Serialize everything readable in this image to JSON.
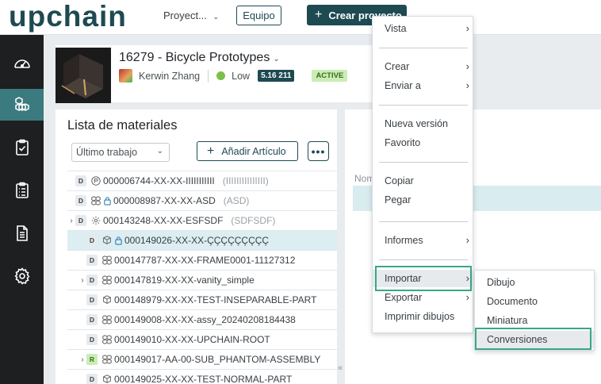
{
  "topbar": {
    "logo": "upchain",
    "project_dropdown": "Proyect...",
    "equipo_label": "Equipo",
    "crear_label": "Crear proyecto"
  },
  "sidebar": {
    "items": [
      {
        "name": "dashboard",
        "icon": "speedometer-icon"
      },
      {
        "name": "parts",
        "icon": "cubes-icon",
        "active": true
      },
      {
        "name": "tasks",
        "icon": "clipboard-check-icon"
      },
      {
        "name": "lists",
        "icon": "clipboard-list-icon"
      },
      {
        "name": "documents",
        "icon": "document-icon"
      },
      {
        "name": "settings",
        "icon": "gear-icon"
      }
    ]
  },
  "project": {
    "title": "16279 - Bicycle Prototypes",
    "owner": "Kerwin Zhang",
    "priority": "Low",
    "version": "5.16 211",
    "status": "ACTIVE"
  },
  "bom": {
    "title": "Lista de materiales",
    "filter_value": "Último trabajo",
    "add_label": "Añadir Artículo",
    "more_label": "•••",
    "rows": [
      {
        "expand": "",
        "badge": "D",
        "icon": "assembly",
        "locked": false,
        "text": "000006744-XX-XX-IIIIIIIIIII",
        "desc": "(IIIIIIIIIIIIIII)",
        "indent": 0
      },
      {
        "expand": "",
        "badge": "D",
        "icon": "assembly",
        "locked": true,
        "text": "000008987-XX-XX-ASD",
        "desc": "(ASD)",
        "indent": 0
      },
      {
        "expand": "›",
        "badge": "D",
        "icon": "gear-assembly",
        "locked": false,
        "text": "000143248-XX-XX-ESFSDF",
        "desc": "(SDFSDF)",
        "indent": 0
      },
      {
        "expand": "",
        "badge": "D",
        "icon": "part",
        "locked": true,
        "text": "000149026-XX-XX-ÇÇÇÇÇÇÇÇÇ",
        "desc": "",
        "indent": 1,
        "selected": true
      },
      {
        "expand": "",
        "badge": "D",
        "icon": "assembly",
        "locked": false,
        "text": "000147787-XX-XX-FRAME0001-11127312",
        "desc": "",
        "indent": 1
      },
      {
        "expand": "›",
        "badge": "D",
        "icon": "assembly",
        "locked": false,
        "text": "000147819-XX-XX-vanity_simple",
        "desc": "",
        "indent": 1
      },
      {
        "expand": "",
        "badge": "D",
        "icon": "part",
        "locked": false,
        "text": "000148979-XX-XX-TEST-INSEPARABLE-PART",
        "desc": "",
        "indent": 1
      },
      {
        "expand": "",
        "badge": "D",
        "icon": "assembly",
        "locked": false,
        "text": "000149008-XX-XX-assy_20240208184438",
        "desc": "",
        "indent": 1
      },
      {
        "expand": "",
        "badge": "D",
        "icon": "assembly",
        "locked": false,
        "text": "000149010-XX-XX-UPCHAIN-ROOT",
        "desc": "",
        "indent": 1
      },
      {
        "expand": "›",
        "badge": "R",
        "icon": "assembly",
        "locked": false,
        "text": "000149017-AA-00-SUB_PHANTOM-ASSEMBLY",
        "desc": "",
        "indent": 1
      },
      {
        "expand": "",
        "badge": "D",
        "icon": "part",
        "locked": false,
        "text": "000149025-XX-XX-TEST-NORMAL-PART",
        "desc": "",
        "indent": 1
      }
    ]
  },
  "right_panel": {
    "column_header": "Nom",
    "collapse_glyph": "«"
  },
  "context_menu": {
    "items": [
      {
        "label": "Vista",
        "arrow": "›"
      },
      {
        "label": "Crear",
        "arrow": "›"
      },
      {
        "label": "Enviar a",
        "arrow": "›"
      },
      {
        "label": "Nueva versión",
        "arrow": ""
      },
      {
        "label": "Favorito",
        "arrow": ""
      },
      {
        "label": "Copiar",
        "arrow": ""
      },
      {
        "label": "Pegar",
        "arrow": ""
      },
      {
        "label": "Informes",
        "arrow": "›"
      },
      {
        "label": "Importar",
        "arrow": "›",
        "highlighted": true
      },
      {
        "label": "Exportar",
        "arrow": "›"
      },
      {
        "label": "Imprimir dibujos",
        "arrow": ""
      }
    ]
  },
  "submenu": {
    "items": [
      {
        "label": "Dibujo"
      },
      {
        "label": "Documento"
      },
      {
        "label": "Miniatura"
      },
      {
        "label": "Conversiones",
        "highlighted": true
      }
    ]
  },
  "colors": {
    "brand": "#1e4a52",
    "sidebar_bg": "#1d1f21",
    "sidebar_active": "#3b7a7e",
    "highlight_border": "#38a786",
    "selected_row": "#dceef1"
  }
}
